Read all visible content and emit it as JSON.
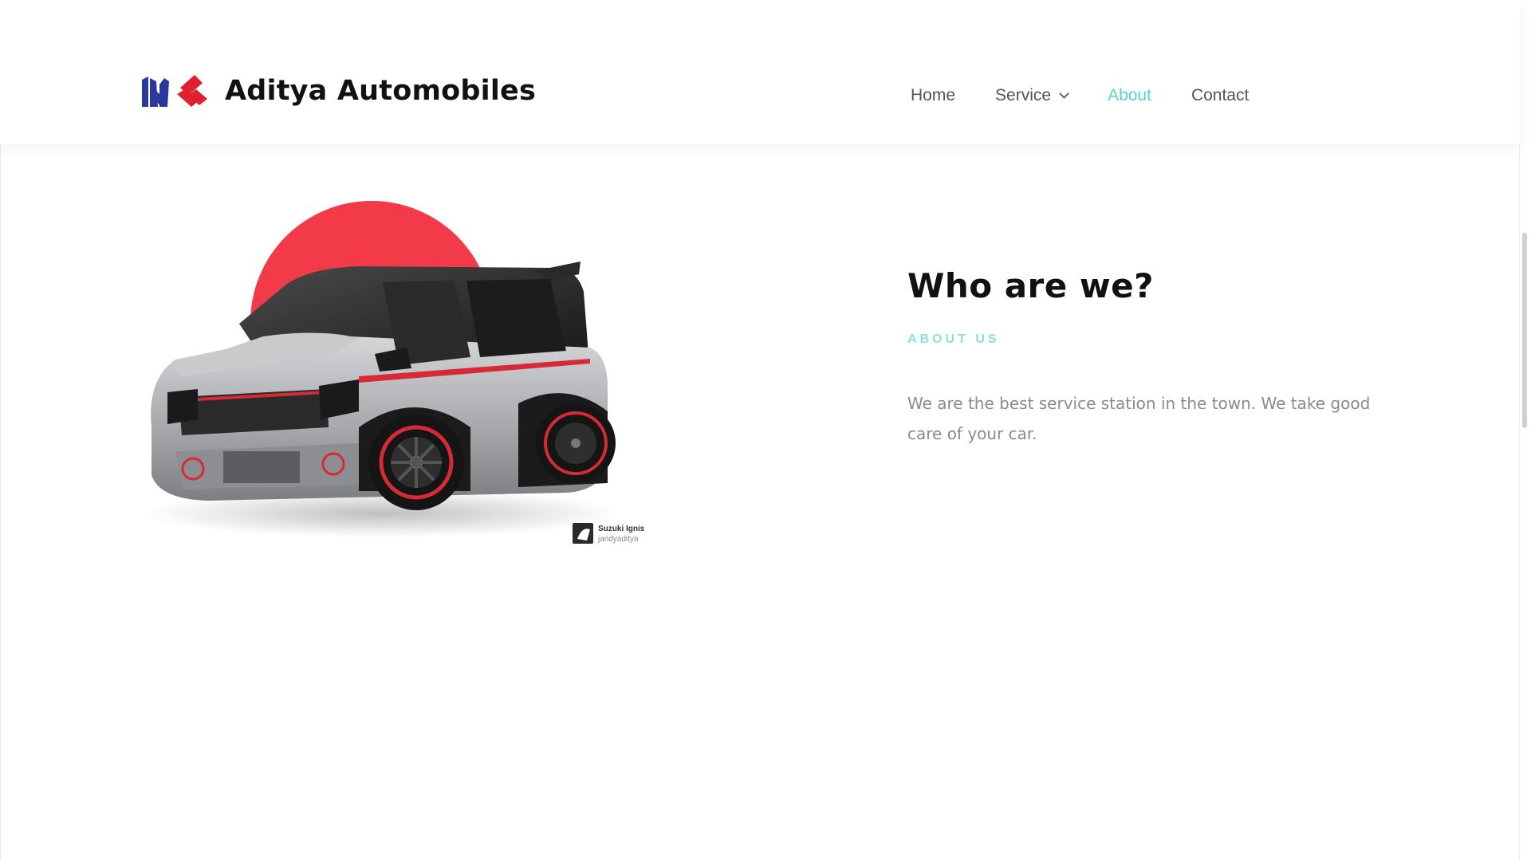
{
  "brand": {
    "name": "Aditya Automobiles",
    "logo_icon": "maruti-suzuki-logo-icon",
    "colors": {
      "maruti_blue": "#2b3a9a",
      "suzuki_red": "#e0202e"
    }
  },
  "nav": {
    "items": [
      {
        "label": "Home",
        "active": false
      },
      {
        "label": "Service",
        "active": false,
        "has_dropdown": true
      },
      {
        "label": "About",
        "active": true
      },
      {
        "label": "Contact",
        "active": false
      }
    ],
    "active_color": "#5ad3c6"
  },
  "about": {
    "title": "Who are we?",
    "kicker": "ABOUT US",
    "body": "We are the best service station in the town. We take good care of your car.",
    "image": {
      "semantic": "car-illustration-suzuki-ignis",
      "caption_title": "Suzuki Ignis",
      "caption_sub": "jandyaditya",
      "circle_color": "#f23a48",
      "car_color": "#a9abad"
    }
  }
}
